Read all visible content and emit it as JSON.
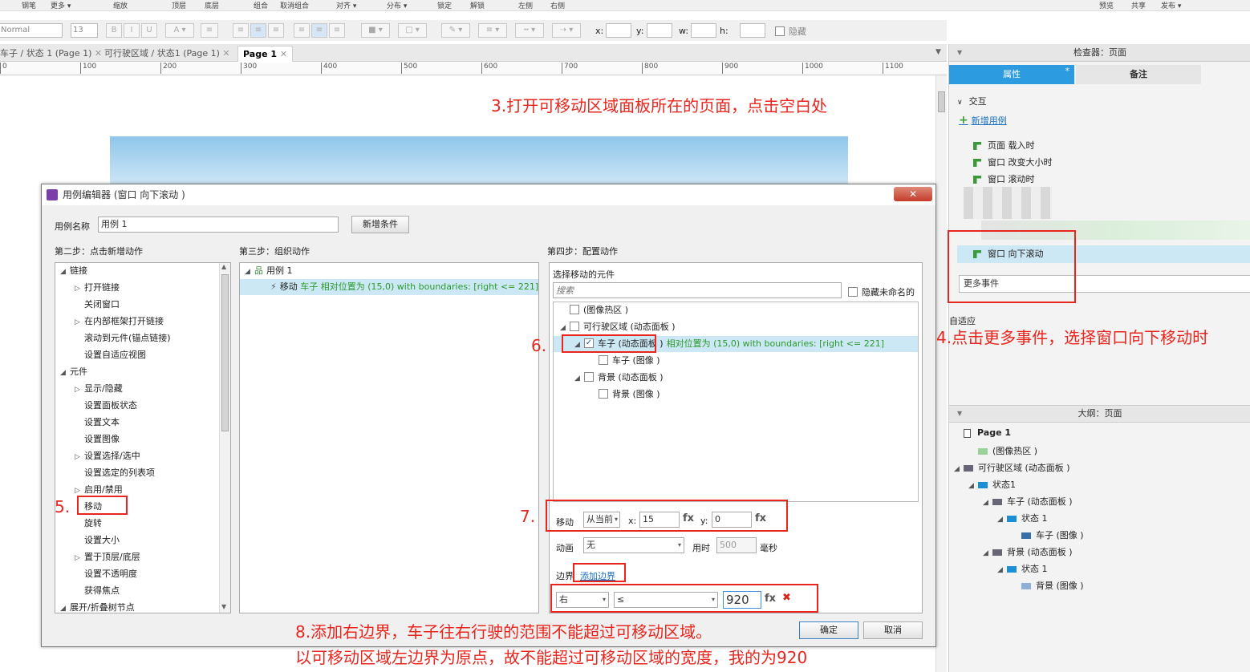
{
  "toolbar": {
    "items": [
      "钢笔",
      "更多 ▾",
      "缩放",
      "顶层",
      "底层",
      "组合",
      "取消组合",
      "对齐 ▾",
      "分布 ▾",
      "锁定",
      "解锁",
      "左侧",
      "右侧",
      "预览",
      "共享",
      "发布 ▾"
    ]
  },
  "format": {
    "style_value": "Normal",
    "font_size": "13",
    "x_label": "x:",
    "y_label": "y:",
    "w_label": "w:",
    "h_label": "h:",
    "hidden_label": "隐藏"
  },
  "tabs": [
    {
      "label": "车子 / 状态 1 (Page 1)"
    },
    {
      "label": "可行驶区域 / 状态1 (Page 1)"
    },
    {
      "label": "Page 1"
    }
  ],
  "ruler_ticks": [
    "0",
    "100",
    "200",
    "300",
    "400",
    "500",
    "600",
    "700",
    "800",
    "900",
    "1000",
    "1100"
  ],
  "annotations": {
    "step3": "3.打开可移动区域面板所在的页面，点击空白处",
    "step4": "4.点击更多事件，选择窗口向下移动时",
    "step5": "5.",
    "step6": "6.",
    "step7": "7.",
    "step8_line1": "8.添加右边界，车子往右行驶的范围不能超过可移动区域。",
    "step8_line2": "以可移动区域左边界为原点，故不能超过可移动区域的宽度，我的为920"
  },
  "dialog": {
    "title": "用例编辑器 (窗口 向下滚动 )",
    "case_name_label": "用例名称",
    "case_name_value": "用例 1",
    "add_condition": "新增条件",
    "step2_title": "第二步：点击新增动作",
    "step3_title": "第三步：组织动作",
    "step4_title": "第四步：配置动作",
    "actions": [
      {
        "label": "链接",
        "level": 0,
        "arrow": "◢"
      },
      {
        "label": "打开链接",
        "level": 1,
        "arrow": "▷"
      },
      {
        "label": "关闭窗口",
        "level": 1,
        "arrow": ""
      },
      {
        "label": "在内部框架打开链接",
        "level": 1,
        "arrow": "▷"
      },
      {
        "label": "滚动到元件(锚点链接)",
        "level": 1,
        "arrow": ""
      },
      {
        "label": "设置自适应视图",
        "level": 1,
        "arrow": ""
      },
      {
        "label": "元件",
        "level": 0,
        "arrow": "◢"
      },
      {
        "label": "显示/隐藏",
        "level": 1,
        "arrow": "▷"
      },
      {
        "label": "设置面板状态",
        "level": 1,
        "arrow": ""
      },
      {
        "label": "设置文本",
        "level": 1,
        "arrow": ""
      },
      {
        "label": "设置图像",
        "level": 1,
        "arrow": ""
      },
      {
        "label": "设置选择/选中",
        "level": 1,
        "arrow": "▷"
      },
      {
        "label": "设置选定的列表项",
        "level": 1,
        "arrow": ""
      },
      {
        "label": "启用/禁用",
        "level": 1,
        "arrow": "▷"
      },
      {
        "label": "移动",
        "level": 1,
        "arrow": ""
      },
      {
        "label": "旋转",
        "level": 1,
        "arrow": ""
      },
      {
        "label": "设置大小",
        "level": 1,
        "arrow": ""
      },
      {
        "label": "置于顶层/底层",
        "level": 1,
        "arrow": "▷"
      },
      {
        "label": "设置不透明度",
        "level": 1,
        "arrow": ""
      },
      {
        "label": "获得焦点",
        "level": 1,
        "arrow": ""
      },
      {
        "label": "展开/折叠树节点",
        "level": 0,
        "arrow": "◢"
      }
    ],
    "organize": {
      "case_label": "用例 1",
      "action_verb": "移动",
      "action_detail": "车子 相对位置为 (15,0)  with boundaries: [right <= 221]"
    },
    "config": {
      "select_title": "选择移动的元件",
      "search_placeholder": "搜索",
      "hide_unnamed": "隐藏未命名的",
      "widgets": [
        {
          "label": "(图像热区 )",
          "level": 0,
          "checked": false,
          "arrow": ""
        },
        {
          "label": "可行驶区域 (动态面板 )",
          "level": 0,
          "checked": false,
          "arrow": "◢"
        },
        {
          "label": "车子 (动态面板 )",
          "level": 1,
          "checked": true,
          "arrow": "◢",
          "detail": "相对位置为 (15,0)  with boundaries: [right <= 221]"
        },
        {
          "label": "车子 (图像 )",
          "level": 2,
          "checked": false,
          "arrow": ""
        },
        {
          "label": "背景 (动态面板 )",
          "level": 1,
          "checked": false,
          "arrow": "◢"
        },
        {
          "label": "背景 (图像 )",
          "level": 2,
          "checked": false,
          "arrow": ""
        }
      ],
      "move_label": "移动",
      "move_mode": "从当前",
      "x_label": "x:",
      "x_value": "15",
      "y_label": "y:",
      "y_value": "0",
      "fx": "fx",
      "anim_label": "动画",
      "anim_value": "无",
      "time_label": "用时",
      "time_value": "500",
      "ms_label": "毫秒",
      "boundary_label": "边界",
      "add_boundary": "添加边界",
      "bound_side": "右",
      "bound_op": "≤",
      "bound_value": "920",
      "remove_icon": "✖"
    },
    "ok": "确定",
    "cancel": "取消"
  },
  "inspector": {
    "title": "检查器：页面",
    "tab_props": "属性",
    "tab_notes": "备注",
    "interaction": "交互",
    "add_case": "新增用例",
    "events": [
      "页面 载入时",
      "窗口 改变大小时",
      "窗口 滚动时"
    ],
    "highlight_event": "窗口 向下滚动",
    "more_events": "更多事件",
    "adaptive": "自适应"
  },
  "outline": {
    "title": "大纲：页面",
    "items": [
      {
        "label": "Page 1",
        "level": 0,
        "arrow": ""
      },
      {
        "label": "(图像热区 )",
        "level": 1,
        "arrow": ""
      },
      {
        "label": "可行驶区域 (动态面板 )",
        "level": 0,
        "arrow": "◢"
      },
      {
        "label": "状态1",
        "level": 1,
        "arrow": "◢"
      },
      {
        "label": "车子 (动态面板 )",
        "level": 2,
        "arrow": "◢"
      },
      {
        "label": "状态 1",
        "level": 3,
        "arrow": "◢"
      },
      {
        "label": "车子 (图像 )",
        "level": 4,
        "arrow": ""
      },
      {
        "label": "背景 (动态面板 )",
        "level": 2,
        "arrow": "◢"
      },
      {
        "label": "状态 1",
        "level": 3,
        "arrow": "◢"
      },
      {
        "label": "背景 (图像 )",
        "level": 4,
        "arrow": ""
      }
    ]
  }
}
